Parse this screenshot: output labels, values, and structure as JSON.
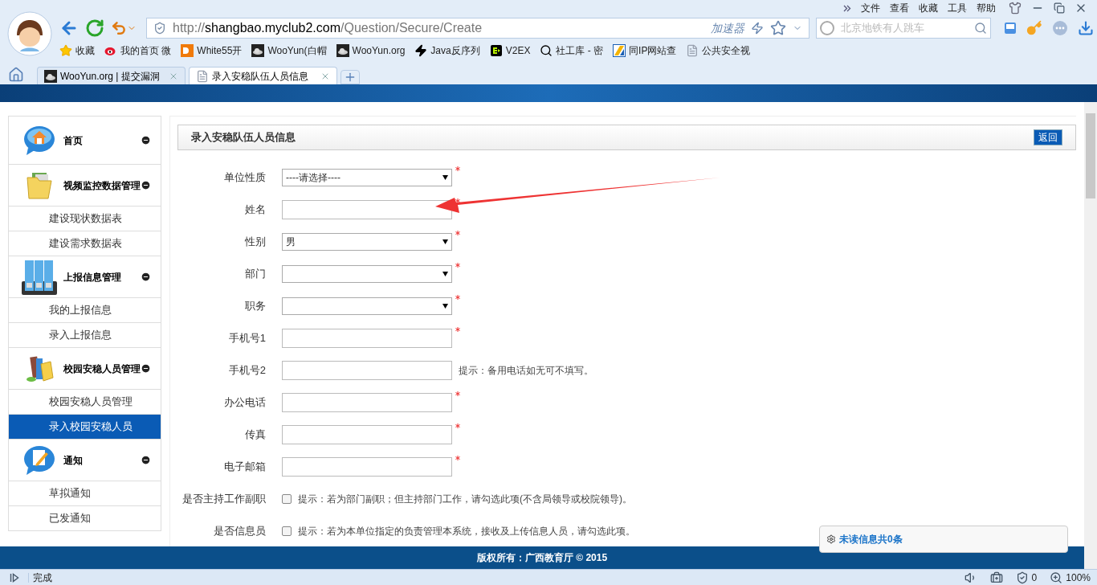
{
  "menu_bar": [
    "文件",
    "查看",
    "收藏",
    "工具",
    "帮助"
  ],
  "address": {
    "scheme": "http://",
    "host": "shangbao.myclub2.com",
    "path": "/Question/Secure/Create",
    "accelerator": "加速器"
  },
  "search": {
    "placeholder": "北京地铁有人跳车"
  },
  "bookmarks": [
    {
      "label": "收藏",
      "kind": "star"
    },
    {
      "label": "我的首页 微",
      "kind": "weibo"
    },
    {
      "label": "White55开",
      "kind": "dy"
    },
    {
      "label": "WooYun(白帽",
      "kind": "wooyun"
    },
    {
      "label": "WooYun.org",
      "kind": "wooyun"
    },
    {
      "label": "Java反序列",
      "kind": "bolt"
    },
    {
      "label": "V2EX",
      "kind": "v2ex"
    },
    {
      "label": "社工库 - 密",
      "kind": "key"
    },
    {
      "label": "同IP网站查",
      "kind": "ip"
    },
    {
      "label": "公共安全视",
      "kind": "page"
    }
  ],
  "tabs": [
    {
      "label": "WooYun.org | 提交漏洞",
      "kind": "wooyun",
      "selected": false
    },
    {
      "label": "录入安稳队伍人员信息",
      "kind": "page",
      "selected": true
    }
  ],
  "sidebar": {
    "groups": [
      {
        "title": "首页",
        "kind": "home",
        "expanded": true
      },
      {
        "title": "视频监控数据管理",
        "kind": "folder",
        "expanded": true,
        "children": [
          {
            "label": "建设现状数据表",
            "selected": false
          },
          {
            "label": "建设需求数据表",
            "selected": false
          }
        ]
      },
      {
        "title": "上报信息管理",
        "kind": "binders",
        "expanded": true,
        "children": [
          {
            "label": "我的上报信息",
            "selected": false
          },
          {
            "label": "录入上报信息",
            "selected": false
          }
        ]
      },
      {
        "title": "校园安稳人员管理",
        "kind": "books",
        "expanded": true,
        "children": [
          {
            "label": "校园安稳人员管理",
            "selected": false
          },
          {
            "label": "录入校园安稳人员",
            "selected": true
          }
        ]
      },
      {
        "title": "通知",
        "kind": "note",
        "expanded": true,
        "children": [
          {
            "label": "草拟通知",
            "selected": false
          },
          {
            "label": "已发通知",
            "selected": false
          }
        ]
      }
    ]
  },
  "panel": {
    "title": "录入安稳队伍人员信息",
    "back_button": "返回"
  },
  "form": [
    {
      "label": "单位性质",
      "kind": "select",
      "value": "----请选择----",
      "required": true
    },
    {
      "label": "姓名",
      "kind": "text",
      "required": true
    },
    {
      "label": "性别",
      "kind": "select",
      "value": "男",
      "required": true
    },
    {
      "label": "部门",
      "kind": "select",
      "required": true
    },
    {
      "label": "职务",
      "kind": "select",
      "required": true
    },
    {
      "label": "手机号1",
      "kind": "text",
      "required": true
    },
    {
      "label": "手机号2",
      "kind": "text",
      "required": false,
      "hint": "提示：备用电话如无可不填写。"
    },
    {
      "label": "办公电话",
      "kind": "text",
      "required": true
    },
    {
      "label": "传真",
      "kind": "text",
      "required": true
    },
    {
      "label": "电子邮箱",
      "kind": "text",
      "required": true
    },
    {
      "label": "是否主持工作副职",
      "kind": "checkbox",
      "checked": false,
      "hint": "提示：若为部门副职；但主持部门工作，请勾选此项(不含局领导或校院领导)。"
    },
    {
      "label": "是否信息员",
      "kind": "checkbox",
      "checked": false,
      "hint": "提示：若为本单位指定的负责管理本系统，接收及上传信息人员，请勾选此项。"
    }
  ],
  "footer": "版权所有：广西教育厅 © 2015",
  "notification": "未读信息共0条",
  "status_bar": {
    "text": "完成",
    "ad_count": "0",
    "zoom": "100%"
  }
}
